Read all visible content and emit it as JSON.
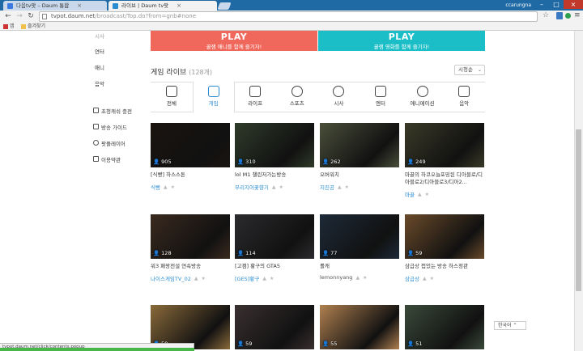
{
  "browser": {
    "tabs": [
      {
        "label": "다음tv팟 – Daum 통합",
        "active": false
      },
      {
        "label": "라이브 | Daum tv팟",
        "active": true
      }
    ],
    "user": "ccarungna",
    "url_host": "tvpot.daum.net",
    "url_path": "/broadcast/Top.do?from=gnb#none",
    "bookmarks": [
      {
        "label": "앱"
      },
      {
        "label": "즐겨찾기"
      }
    ],
    "status_url": "tvpot.daum.net/click/contents.popup"
  },
  "banners": [
    {
      "logo": "PLAY",
      "sub": "꿀잼 애니를 함께 즐기자!",
      "color": "#f0685c"
    },
    {
      "logo": "PLAY",
      "sub": "꿀잼 영화를 함께 즐기자!",
      "color": "#1bbec6"
    }
  ],
  "sidebar": {
    "links": [
      "시사",
      "연터",
      "애니",
      "음악"
    ],
    "tools": [
      {
        "label": "초청캐쉬 충전",
        "icon": "cash-icon"
      },
      {
        "label": "방송 가이드",
        "icon": "guide-icon"
      },
      {
        "label": "팟플레이어",
        "icon": "play-icon"
      },
      {
        "label": "이용약관",
        "icon": "terms-icon"
      }
    ]
  },
  "section": {
    "title": "게임 라이브",
    "count": "(128개)",
    "sort": "시청순"
  },
  "categories": [
    {
      "label": "전체",
      "icon": "layers-icon"
    },
    {
      "label": "게임",
      "icon": "hand-icon",
      "selected": true
    },
    {
      "label": "라이프",
      "icon": "bowl-icon"
    },
    {
      "label": "스포츠",
      "icon": "ball-icon"
    },
    {
      "label": "시사",
      "icon": "globe-icon"
    },
    {
      "label": "엔터",
      "icon": "screen-icon"
    },
    {
      "label": "애니메이션",
      "icon": "character-icon"
    },
    {
      "label": "음악",
      "icon": "note-icon"
    }
  ],
  "videos": [
    {
      "viewers": "905",
      "title": "[식빵] 하스스톤",
      "author": "식빵",
      "bg": "#1a1410"
    },
    {
      "viewers": "310",
      "title": "lol M1 챌린저가는방송",
      "author": "부리지어꽃향기",
      "bg": "#2f3b2a"
    },
    {
      "viewers": "262",
      "title": "오버워치",
      "author": "지진공",
      "bg": "#4a4f3a"
    },
    {
      "viewers": "249",
      "title": "마끌의 하코오늘포밍된 디아블로/디아블로2/디아블로3/디아2...",
      "author": "마끌",
      "bg": "#3a3a28"
    },
    {
      "viewers": "128",
      "title": "워3 패왕전설 연속방송",
      "author": "나이스게임TV_02",
      "bg": "#3a2a1e"
    },
    {
      "viewers": "114",
      "title": "[고겜] 황구의 GTA5",
      "author": "[GES]황구",
      "bg": "#2b2b2e"
    },
    {
      "viewers": "77",
      "title": "롤캐",
      "author": "lemonnyang",
      "bg": "#1d2a38"
    },
    {
      "viewers": "59",
      "title": "삼급상 접었는 방송 하스정관",
      "author": "삼급상",
      "bg": "#6a4a2a"
    },
    {
      "viewers": "59",
      "title": "",
      "author": "",
      "bg": "#8a6a3a"
    },
    {
      "viewers": "59",
      "title": "",
      "author": "",
      "bg": "#3a3030"
    },
    {
      "viewers": "55",
      "title": "",
      "author": "",
      "bg": "#b08050"
    },
    {
      "viewers": "51",
      "title": "",
      "author": "",
      "bg": "#3a4a3a"
    }
  ],
  "footer": {
    "language": "한국어"
  }
}
